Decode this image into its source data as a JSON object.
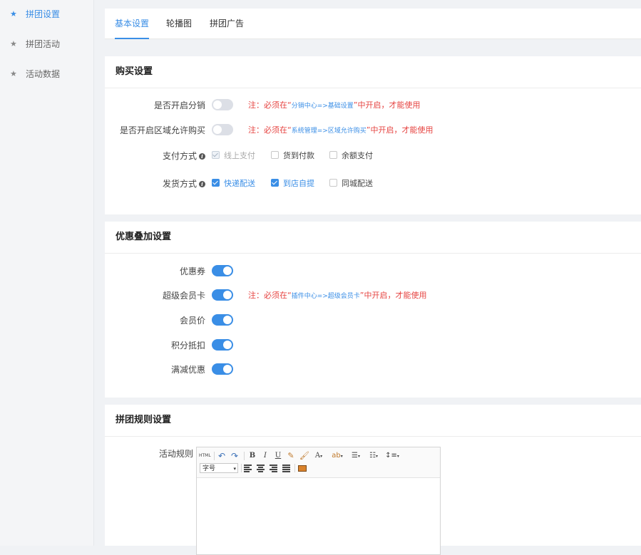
{
  "sidebar": {
    "items": [
      {
        "label": "拼团设置",
        "icon": "star-icon",
        "active": true
      },
      {
        "label": "拼团活动",
        "icon": "star-icon",
        "active": false
      },
      {
        "label": "活动数据",
        "icon": "star-icon",
        "active": false
      }
    ]
  },
  "tabs": [
    {
      "label": "基本设置",
      "active": true
    },
    {
      "label": "轮播图",
      "active": false
    },
    {
      "label": "拼团广告",
      "active": false
    }
  ],
  "purchase": {
    "title": "购买设置",
    "distribution": {
      "label": "是否开启分销",
      "on": false,
      "note_prefix": "注：必须在“",
      "note_link": "分销中心=>基础设置",
      "note_suffix": "”中开启，才能使用"
    },
    "region": {
      "label": "是否开启区域允许购买",
      "on": false,
      "note_prefix": "注：必须在“",
      "note_link": "系统管理=>区域允许购买",
      "note_suffix": "”中开启，才能使用"
    },
    "payment": {
      "label": "支付方式",
      "options": [
        {
          "label": "线上支付",
          "state": "disabled-checked"
        },
        {
          "label": "货到付款",
          "state": "unchecked"
        },
        {
          "label": "余额支付",
          "state": "unchecked"
        }
      ]
    },
    "delivery": {
      "label": "发货方式",
      "options": [
        {
          "label": "快递配送",
          "state": "checked"
        },
        {
          "label": "到店自提",
          "state": "checked"
        },
        {
          "label": "同城配送",
          "state": "unchecked"
        }
      ]
    }
  },
  "discount": {
    "title": "优惠叠加设置",
    "coupon": {
      "label": "优惠券",
      "on": true
    },
    "supercard": {
      "label": "超级会员卡",
      "on": true,
      "note_prefix": "注：必须在“",
      "note_link": "插件中心=>超级会员卡",
      "note_suffix": "”中开启，才能使用"
    },
    "member_price": {
      "label": "会员价",
      "on": true
    },
    "points": {
      "label": "积分抵扣",
      "on": true
    },
    "full_reduction": {
      "label": "满减优惠",
      "on": true
    }
  },
  "rules": {
    "title": "拼团规则设置",
    "label": "活动规则",
    "editor": {
      "html_btn": "HTML",
      "bold": "B",
      "italic": "I",
      "underline": "U",
      "font_color": "A",
      "font_size": "字号"
    }
  },
  "colors": {
    "accent": "#3a8ee6",
    "note_red": "#e64340"
  }
}
